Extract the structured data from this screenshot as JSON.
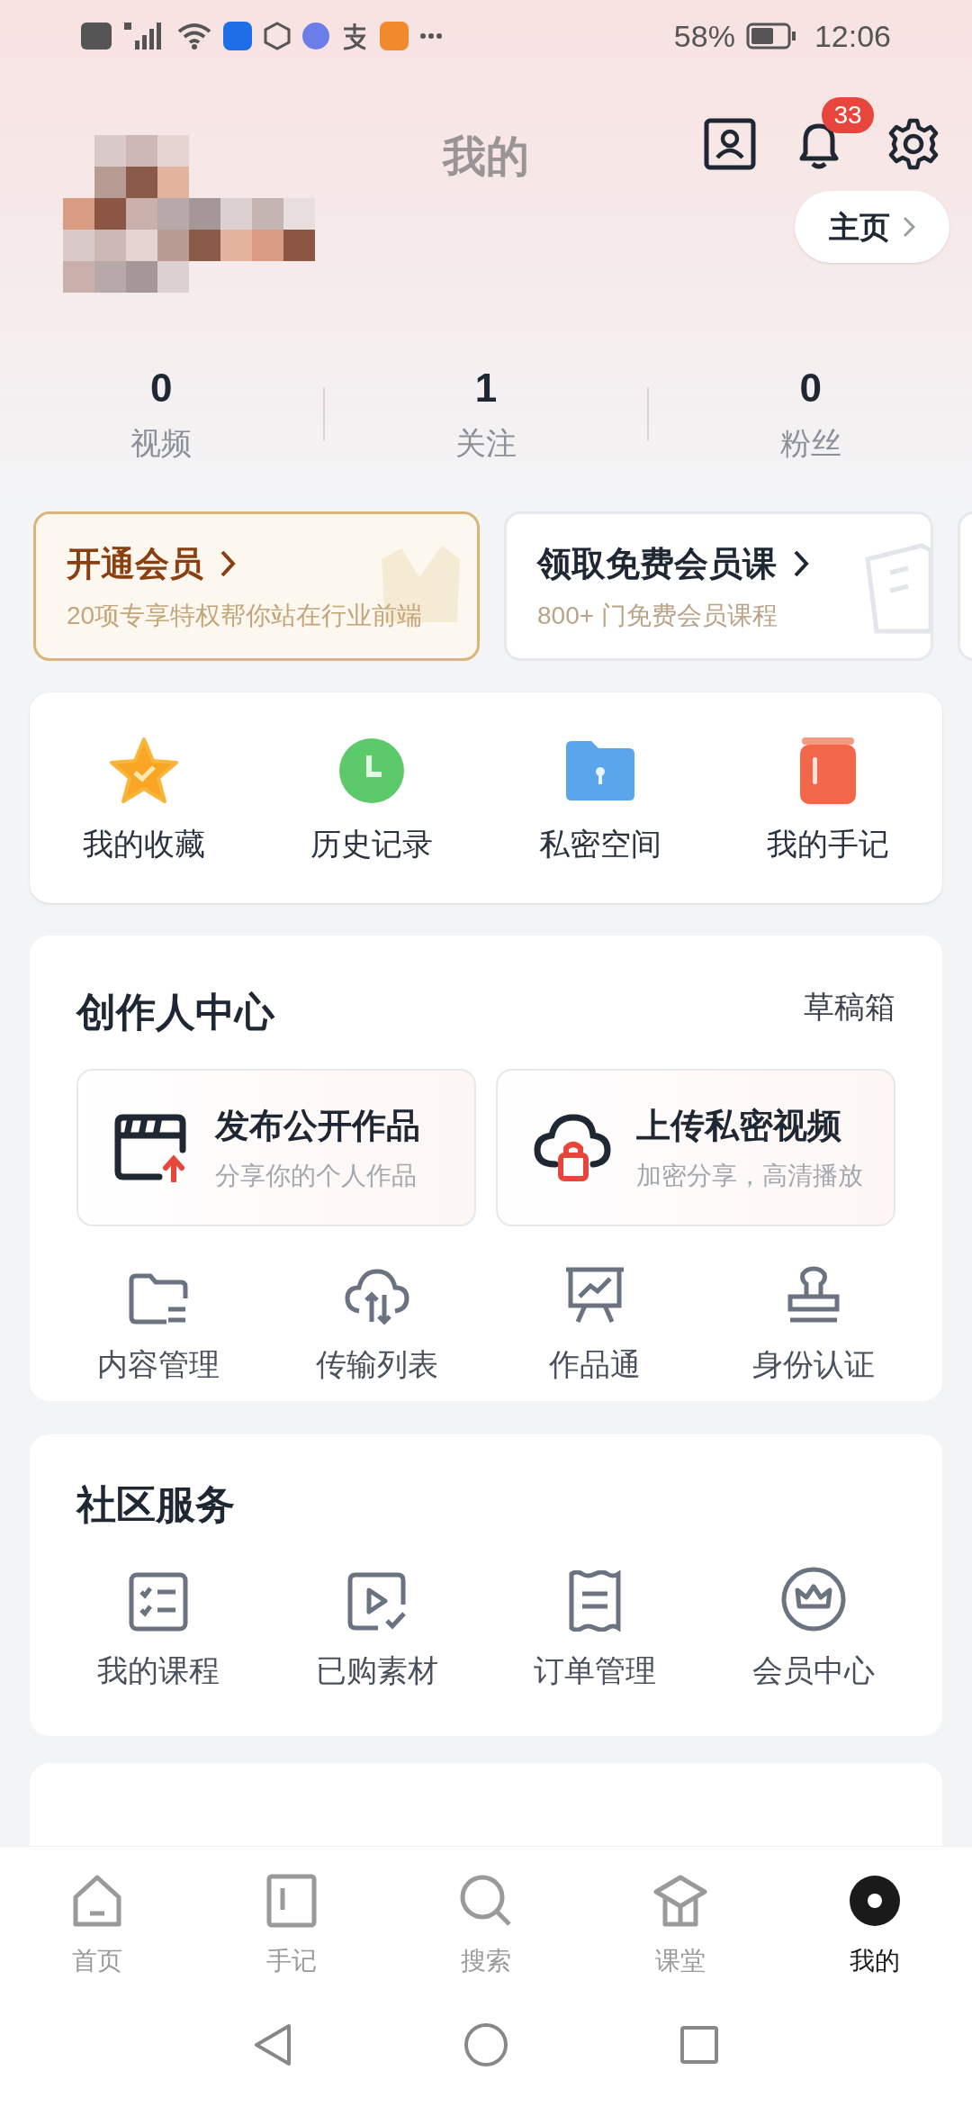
{
  "status_bar": {
    "battery": "58%",
    "time": "12:06"
  },
  "header": {
    "title": "我的",
    "badge": "33",
    "home_button": "主页"
  },
  "stats": [
    {
      "value": "0",
      "label": "视频"
    },
    {
      "value": "1",
      "label": "关注"
    },
    {
      "value": "0",
      "label": "粉丝"
    }
  ],
  "vip_cards": [
    {
      "kind": "gold",
      "title": "开通会员",
      "subtitle": "20项专享特权帮你站在行业前端"
    },
    {
      "kind": "plain",
      "title": "领取免费会员课",
      "subtitle": "800+ 门免费会员课程"
    }
  ],
  "shortcuts": [
    {
      "label": "我的收藏"
    },
    {
      "label": "历史记录"
    },
    {
      "label": "私密空间"
    },
    {
      "label": "我的手记"
    }
  ],
  "creator": {
    "title": "创作人中心",
    "drafts": "草稿箱",
    "actions": [
      {
        "title": "发布公开作品",
        "subtitle": "分享你的个人作品"
      },
      {
        "title": "上传私密视频",
        "subtitle": "加密分享，高清播放"
      }
    ],
    "tools": [
      {
        "label": "内容管理"
      },
      {
        "label": "传输列表"
      },
      {
        "label": "作品通"
      },
      {
        "label": "身份认证"
      }
    ]
  },
  "community": {
    "title": "社区服务",
    "items": [
      {
        "label": "我的课程"
      },
      {
        "label": "已购素材"
      },
      {
        "label": "订单管理"
      },
      {
        "label": "会员中心"
      }
    ]
  },
  "nav": [
    {
      "label": "首页",
      "selected": false
    },
    {
      "label": "手记",
      "selected": false
    },
    {
      "label": "搜索",
      "selected": false
    },
    {
      "label": "课堂",
      "selected": false
    },
    {
      "label": "我的",
      "selected": true
    }
  ]
}
